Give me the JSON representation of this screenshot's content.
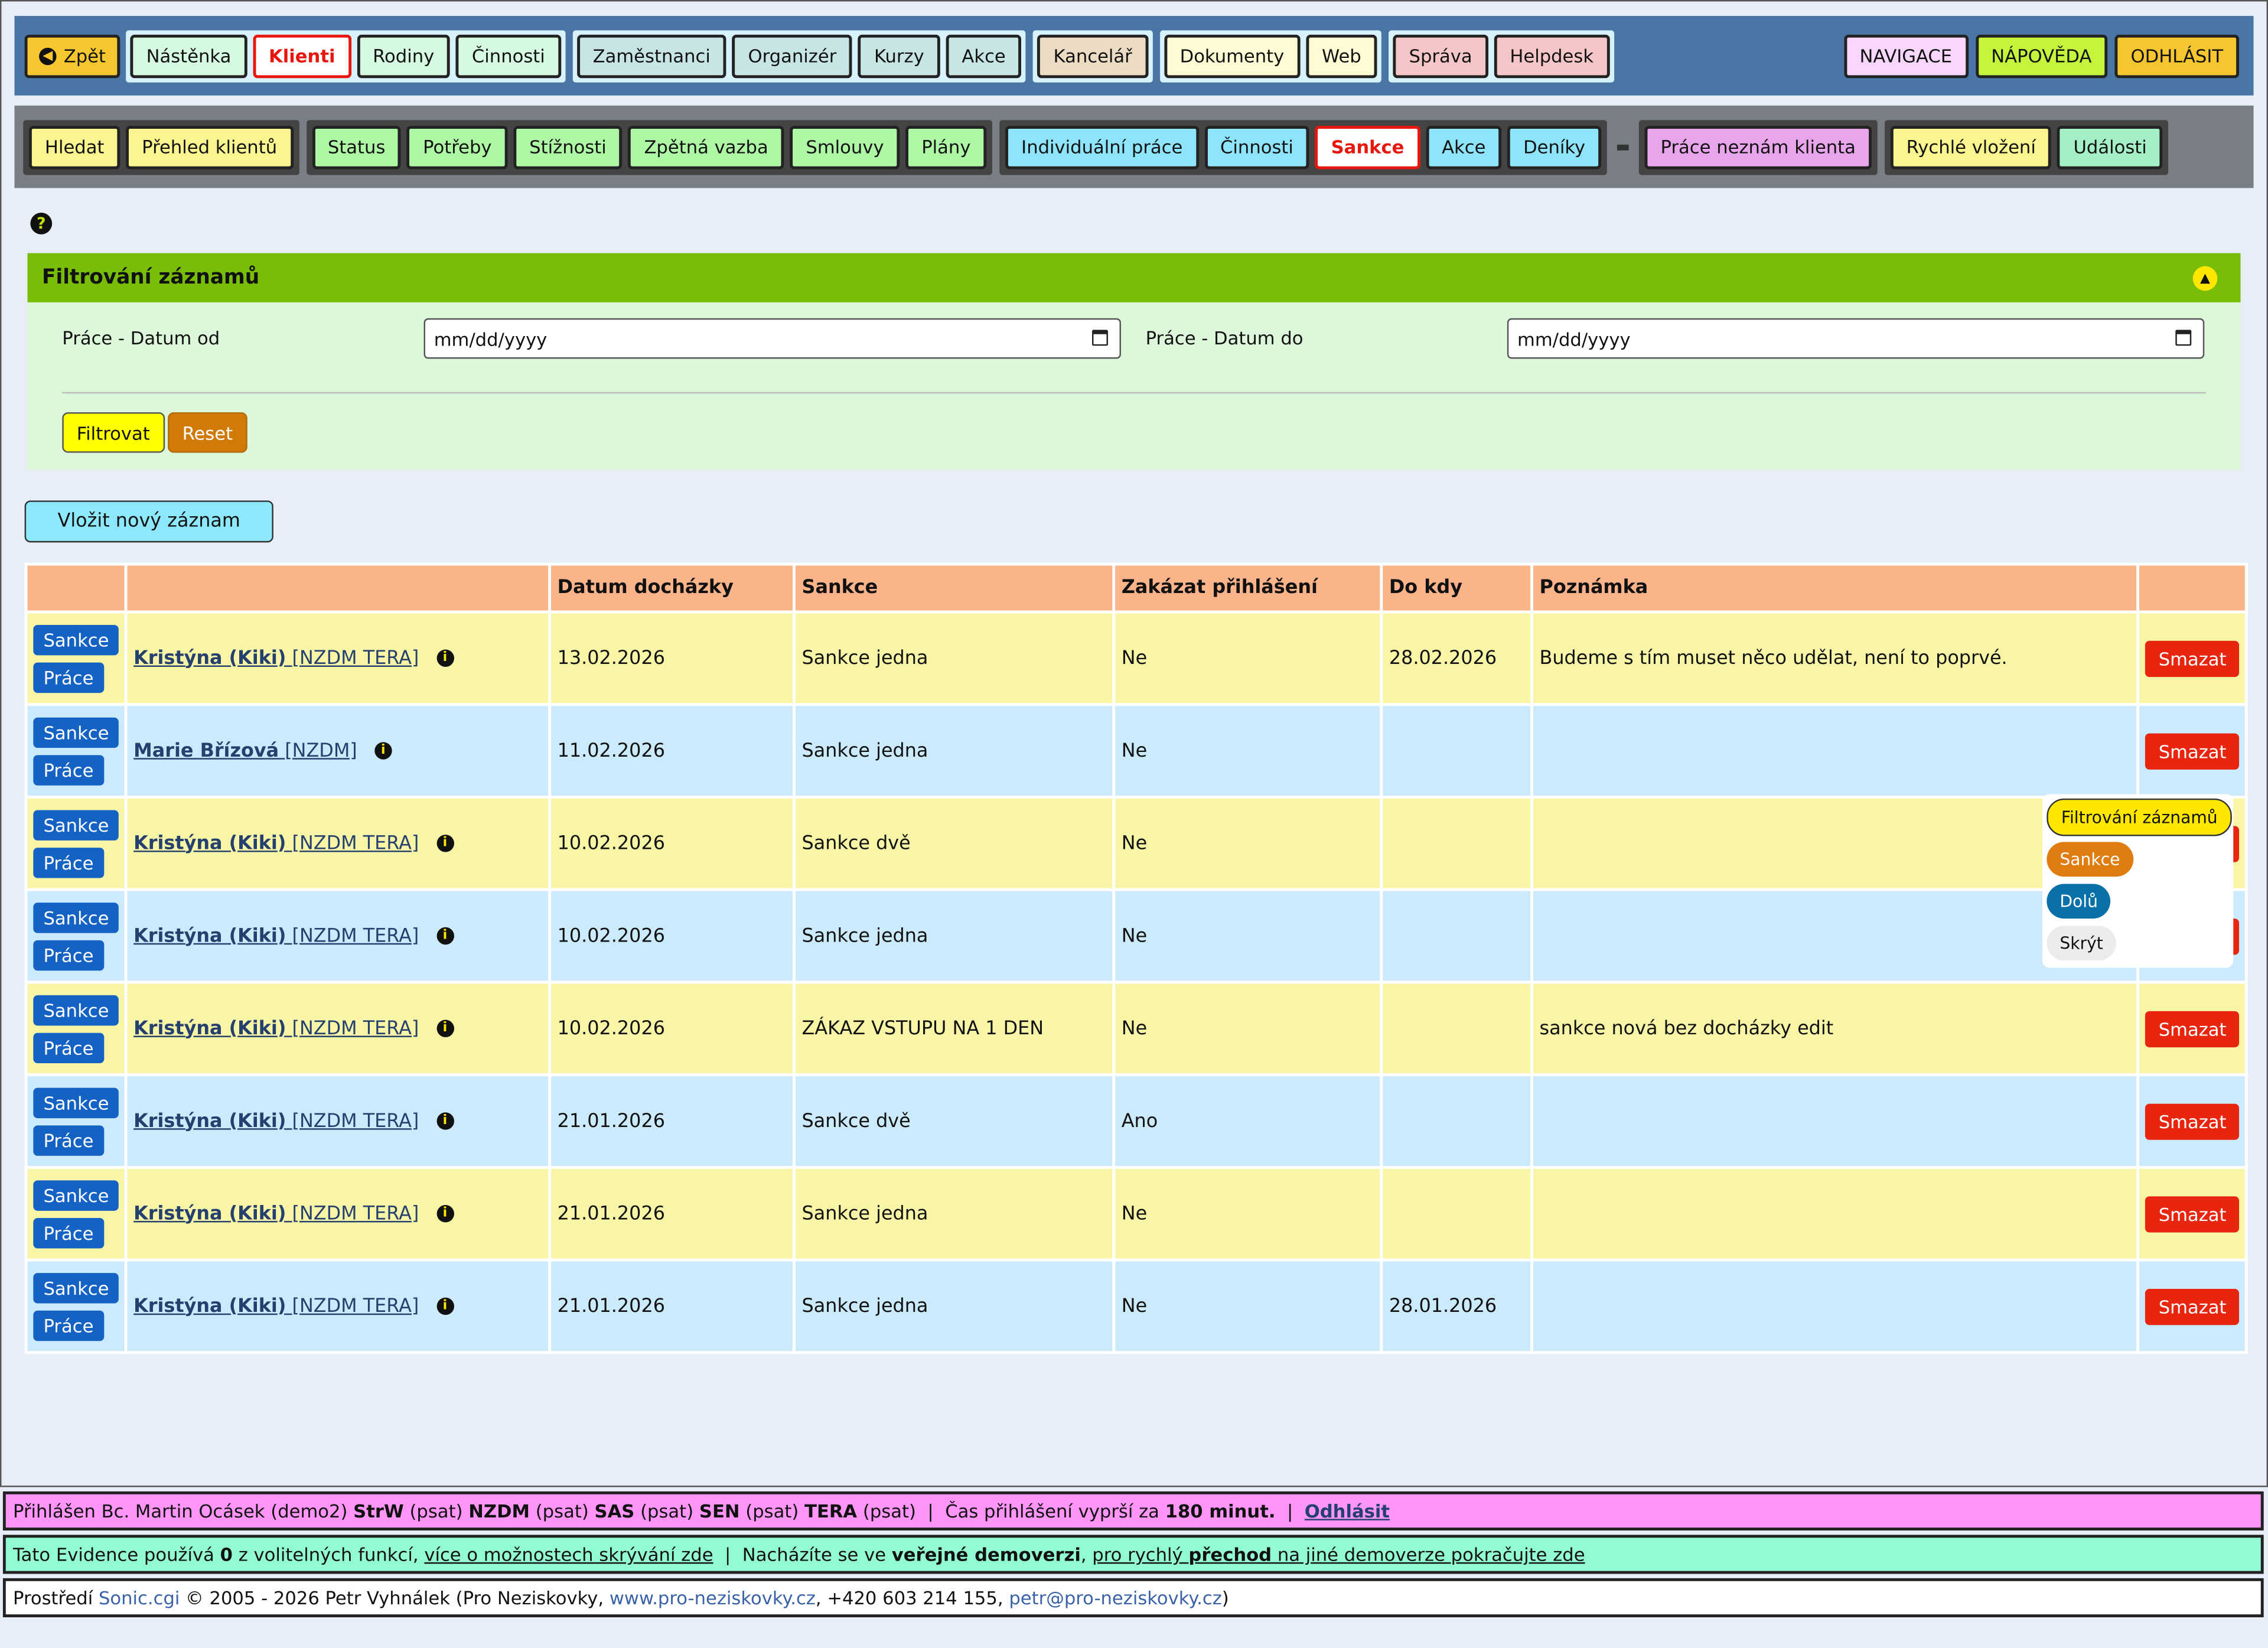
{
  "top_nav": {
    "back": "Zpět",
    "groups": [
      {
        "bg": "#d8f2fb",
        "items": [
          {
            "label": "Nástěnka",
            "color": "#d6f9e1"
          },
          {
            "label": "Klienti",
            "color": "#ffffff",
            "active": true
          },
          {
            "label": "Rodiny",
            "color": "#d6f9e1"
          },
          {
            "label": "Činnosti",
            "color": "#d6f9e1"
          }
        ]
      },
      {
        "bg": "#d8f2fb",
        "items": [
          {
            "label": "Zaměstnanci",
            "color": "#c7e5e5"
          },
          {
            "label": "Organizér",
            "color": "#c7e5e5"
          },
          {
            "label": "Kurzy",
            "color": "#c7e5e5"
          },
          {
            "label": "Akce",
            "color": "#c7e5e5"
          }
        ]
      },
      {
        "bg": "#d8f2fb",
        "items": [
          {
            "label": "Kancelář",
            "color": "#ecdcc4"
          }
        ]
      },
      {
        "bg": "#d8f2fb",
        "items": [
          {
            "label": "Dokumenty",
            "color": "#fdfbd4"
          },
          {
            "label": "Web",
            "color": "#fdfbd4"
          }
        ]
      },
      {
        "bg": "#d8f2fb",
        "items": [
          {
            "label": "Správa",
            "color": "#f5c6c8"
          },
          {
            "label": "Helpdesk",
            "color": "#f5c6c8"
          }
        ]
      }
    ],
    "right": [
      {
        "label": "NAVIGACE",
        "color": "#f9d6fb"
      },
      {
        "label": "NÁPOVĚDA",
        "color": "#c4f43c"
      },
      {
        "label": "ODHLÁSIT",
        "color": "#f6c630"
      }
    ]
  },
  "sub_nav": {
    "groups": [
      {
        "items": [
          {
            "label": "Hledat",
            "color": "#fbf58f"
          },
          {
            "label": "Přehled klientů",
            "color": "#fbf58f"
          }
        ]
      },
      {
        "items": [
          {
            "label": "Status",
            "color": "#aef7a5"
          },
          {
            "label": "Potřeby",
            "color": "#aef7a5"
          },
          {
            "label": "Stížnosti",
            "color": "#aef7a5"
          },
          {
            "label": "Zpětná vazba",
            "color": "#aef7a5"
          },
          {
            "label": "Smlouvy",
            "color": "#aef7a5"
          },
          {
            "label": "Plány",
            "color": "#aef7a5"
          }
        ]
      },
      {
        "items": [
          {
            "label": "Individuální práce",
            "color": "#8ee5fb"
          },
          {
            "label": "Činnosti",
            "color": "#8ee5fb"
          },
          {
            "label": "Sankce",
            "color": "#ffffff",
            "active": true
          },
          {
            "label": "Akce",
            "color": "#8ee5fb"
          },
          {
            "label": "Deníky",
            "color": "#8ee5fb"
          }
        ]
      },
      {
        "sep": true,
        "items": [
          {
            "label": "Práce neznám klienta",
            "color": "#e9a5ec"
          }
        ]
      },
      {
        "items": [
          {
            "label": "Rychlé vložení",
            "color": "#fbf58f"
          },
          {
            "label": "Události",
            "color": "#a4efc6"
          }
        ]
      }
    ]
  },
  "filter": {
    "title": "Filtrování záznamů",
    "date_from_label": "Práce - Datum od",
    "date_to_label": "Práce - Datum do",
    "date_placeholder": "mm/dd/yyyy",
    "filter_btn": "Filtrovat",
    "reset_btn": "Reset"
  },
  "new_record": "Vložit nový záznam",
  "table": {
    "headers": [
      "",
      "",
      "Datum docházky",
      "Sankce",
      "Zakázat přihlášení",
      "Do kdy",
      "Poznámka",
      ""
    ],
    "action_sankce": "Sankce",
    "action_prace": "Práce",
    "delete": "Smazat",
    "rows": [
      {
        "name": "Kristýna",
        "nick": "Kiki",
        "tags": "[NZDM TERA]",
        "date": "13.02.2026",
        "sanction": "Sankce jedna",
        "block": "Ne",
        "until": "28.02.2026",
        "note": "Budeme s tím muset něco udělat, není to poprvé."
      },
      {
        "name": "Marie Břízová",
        "nick": "",
        "tags": "[NZDM]",
        "date": "11.02.2026",
        "sanction": "Sankce jedna",
        "block": "Ne",
        "until": "",
        "note": ""
      },
      {
        "name": "Kristýna",
        "nick": "Kiki",
        "tags": "[NZDM TERA]",
        "date": "10.02.2026",
        "sanction": "Sankce dvě",
        "block": "Ne",
        "until": "",
        "note": ""
      },
      {
        "name": "Kristýna",
        "nick": "Kiki",
        "tags": "[NZDM TERA]",
        "date": "10.02.2026",
        "sanction": "Sankce jedna",
        "block": "Ne",
        "until": "",
        "note": ""
      },
      {
        "name": "Kristýna",
        "nick": "Kiki",
        "tags": "[NZDM TERA]",
        "date": "10.02.2026",
        "sanction": "ZÁKAZ VSTUPU NA 1 DEN",
        "block": "Ne",
        "until": "",
        "note": "sankce nová bez docházky edit"
      },
      {
        "name": "Kristýna",
        "nick": "Kiki",
        "tags": "[NZDM TERA]",
        "date": "21.01.2026",
        "sanction": "Sankce dvě",
        "block": "Ano",
        "until": "",
        "note": ""
      },
      {
        "name": "Kristýna",
        "nick": "Kiki",
        "tags": "[NZDM TERA]",
        "date": "21.01.2026",
        "sanction": "Sankce jedna",
        "block": "Ne",
        "until": "",
        "note": ""
      },
      {
        "name": "Kristýna",
        "nick": "Kiki",
        "tags": "[NZDM TERA]",
        "date": "21.01.2026",
        "sanction": "Sankce jedna",
        "block": "Ne",
        "until": "28.01.2026",
        "note": ""
      }
    ]
  },
  "popup": {
    "items": [
      {
        "label": "Filtrování záznamů",
        "bg": "#ffe700",
        "fg": "#111"
      },
      {
        "label": "Sankce",
        "bg": "#e07d10",
        "fg": "#fff"
      },
      {
        "label": "Dolů",
        "bg": "#0a70a8",
        "fg": "#fff"
      },
      {
        "label": "Skrýt",
        "bg": "#ececec",
        "fg": "#111"
      }
    ]
  },
  "footer": {
    "line1": {
      "prefix": "Přihlášen Bc. Martin Ocásek (demo2) ",
      "orgs": [
        [
          "StrW",
          "(psat)"
        ],
        [
          "NZDM",
          "(psat)"
        ],
        [
          "SAS",
          "(psat)"
        ],
        [
          "SEN",
          "(psat)"
        ],
        [
          "TERA",
          "(psat)"
        ]
      ],
      "expire_prefix": "Čas přihlášení vyprší za ",
      "expire": "180 minut.",
      "logout": "Odhlásit"
    },
    "line2": {
      "a": "Tato Evidence používá ",
      "count": "0",
      "b": " z volitelných funkcí, ",
      "link1": "více o možnostech skrývání zde",
      "c": "Nacházíte se ve ",
      "demo": "veřejné demoverzi",
      "l2a": "pro rychlý ",
      "l2b": "přechod",
      "l2c": " na jiné demoverze pokračujte zde"
    },
    "line3": {
      "a": "Prostředí ",
      "sonic": "Sonic.cgi",
      "b": " © 2005 - 2026 Petr Vyhnálek (Pro Neziskovky, ",
      "web": "www.pro-neziskovky.cz",
      "c": ", +420 603 214 155, ",
      "mail": "petr@pro-neziskovky.cz",
      "d": ")"
    }
  }
}
